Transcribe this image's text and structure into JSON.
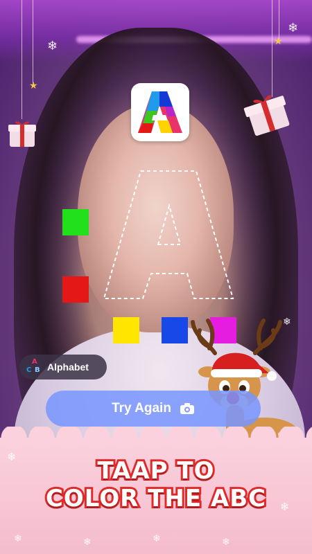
{
  "alphabet_chip": {
    "label": "Alphabet",
    "icon": "abc-letters-icon"
  },
  "try_again": {
    "label": "Try Again",
    "icon": "camera-icon"
  },
  "headline": {
    "line1": "TAAP TO",
    "line2": "COLOR THE ABC"
  },
  "colors": {
    "swatch_green": "#22e01c",
    "swatch_red": "#e51818",
    "swatch_yellow": "#ffe600",
    "swatch_blue": "#1848e8",
    "swatch_magenta": "#e61de0",
    "accent_pink": "#f7c5d3",
    "headline_stroke": "#e02a2a"
  },
  "logo": {
    "icon": "colorful-letter-a-icon"
  },
  "traced_letter": "A"
}
